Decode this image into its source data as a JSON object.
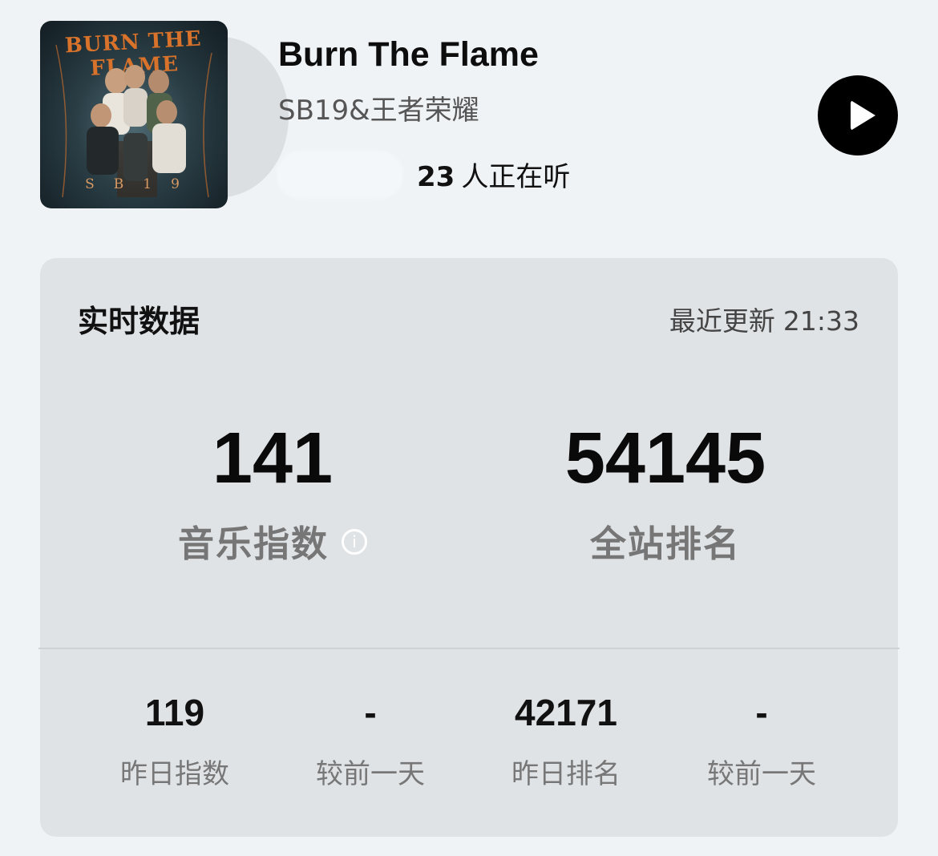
{
  "song": {
    "title": "Burn The Flame",
    "artist": "SB19&王者荣耀",
    "listeners_count": "23",
    "listeners_suffix": "人正在听",
    "cover_art_title": "BURN THE FLAME",
    "cover_art_band": "SB19"
  },
  "player": {
    "play_icon": "play-icon"
  },
  "realtime": {
    "title": "实时数据",
    "updated_label": "最近更新",
    "updated_time": "21:33",
    "music_index": {
      "value": "141",
      "label": "音乐指数"
    },
    "site_rank": {
      "value": "54145",
      "label": "全站排名"
    },
    "yesterday_index": {
      "value": "119",
      "label": "昨日指数"
    },
    "index_change": {
      "value": "-",
      "label": "较前一天"
    },
    "yesterday_rank": {
      "value": "42171",
      "label": "昨日排名"
    },
    "rank_change": {
      "value": "-",
      "label": "较前一天"
    }
  }
}
